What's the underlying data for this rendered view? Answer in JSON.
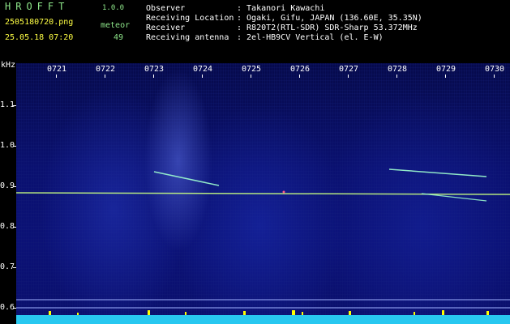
{
  "header": {
    "brand": "HROFFT",
    "version": "1.0.0",
    "filename": "2505180720.png",
    "datetime": "25.05.18 07:20",
    "meteor_label": "meteor",
    "meteor_count": "49",
    "info_labels": {
      "observer": "Observer",
      "location": "Receiving Location",
      "receiver": "Receiver",
      "antenna": "Receiving antenna"
    },
    "info_values": {
      "observer": ": Takanori Kawachi",
      "location": ": Ogaki, Gifu, JAPAN (136.60E, 35.35N)",
      "receiver": ": R820T2(RTL-SDR) SDR-Sharp 53.372MHz",
      "antenna": ": 2el-HB9CV Vertical (el. E-W)"
    }
  },
  "axis": {
    "unit": "kHz",
    "y_ticks": [
      "1.1",
      "1.0",
      "0.9",
      "0.8",
      "0.7",
      "0.6"
    ],
    "x_ticks": [
      "0721",
      "0722",
      "0723",
      "0724",
      "0725",
      "0726",
      "0727",
      "0728",
      "0729",
      "0730"
    ]
  },
  "colors": {
    "background": "#0a0f6c",
    "carrier": "#c8ff80",
    "echo": "#9fffd0",
    "bottom_bar": "#28c8f0",
    "bottom_spikes": "#ffff00"
  }
}
